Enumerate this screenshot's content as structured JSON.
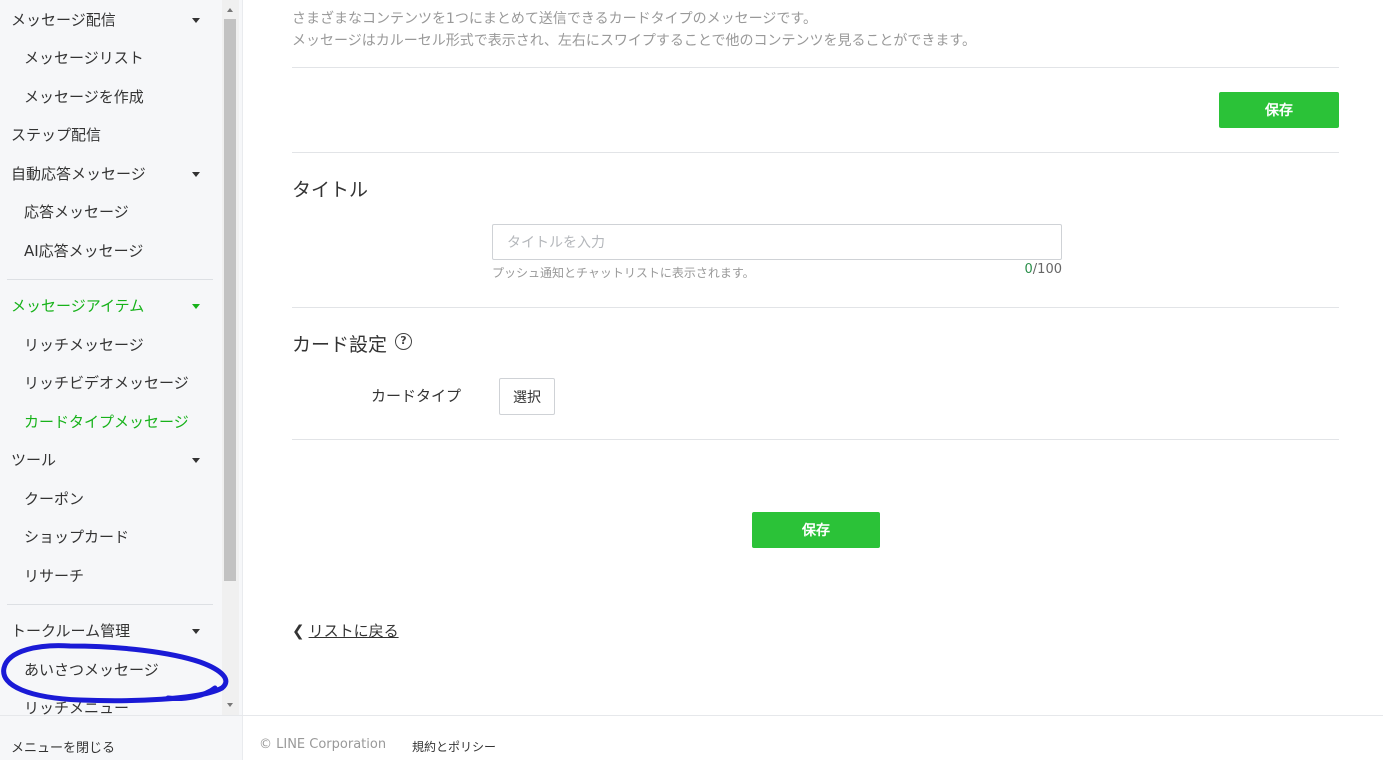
{
  "sidebar": {
    "items": [
      {
        "label": "メッセージ配信"
      },
      {
        "label": "メッセージリスト"
      },
      {
        "label": "メッセージを作成"
      },
      {
        "label": "ステップ配信"
      },
      {
        "label": "自動応答メッセージ"
      },
      {
        "label": "応答メッセージ"
      },
      {
        "label": "AI応答メッセージ"
      },
      {
        "label": "メッセージアイテム"
      },
      {
        "label": "リッチメッセージ"
      },
      {
        "label": "リッチビデオメッセージ"
      },
      {
        "label": "カードタイプメッセージ"
      },
      {
        "label": "ツール"
      },
      {
        "label": "クーポン"
      },
      {
        "label": "ショップカード"
      },
      {
        "label": "リサーチ"
      },
      {
        "label": "トークルーム管理"
      },
      {
        "label": "あいさつメッセージ"
      },
      {
        "label": "リッチメニュー"
      }
    ],
    "active_item": "カードタイプメッセージ",
    "close_menu_label": "メニューを閉じる"
  },
  "main": {
    "description_line1": "さまざまなコンテンツを1つにまとめて送信できるカードタイプのメッセージです。",
    "description_line2": "メッセージはカルーセル形式で表示され、左右にスワイプすることで他のコンテンツを見ることができます。",
    "save_top_label": "保存",
    "title_section": {
      "heading": "タイトル",
      "placeholder": "タイトルを入力",
      "value": "",
      "hint": "プッシュ通知とチャットリストに表示されます。",
      "counter_current": "0",
      "counter_max": "/100"
    },
    "card_section": {
      "heading": "カード設定",
      "help_icon": "?",
      "card_type_label": "カードタイプ",
      "select_label": "選択"
    },
    "save_bottom_label": "保存",
    "back_link_chevron": "❮",
    "back_link_label": "リストに戻る"
  },
  "footer": {
    "copyright": "© LINE Corporation",
    "policy_link": "規約とポリシー"
  },
  "colors": {
    "accent_green": "#2bc238",
    "active_nav_green": "#17b21a",
    "annotation_blue": "#1a1ad6"
  }
}
